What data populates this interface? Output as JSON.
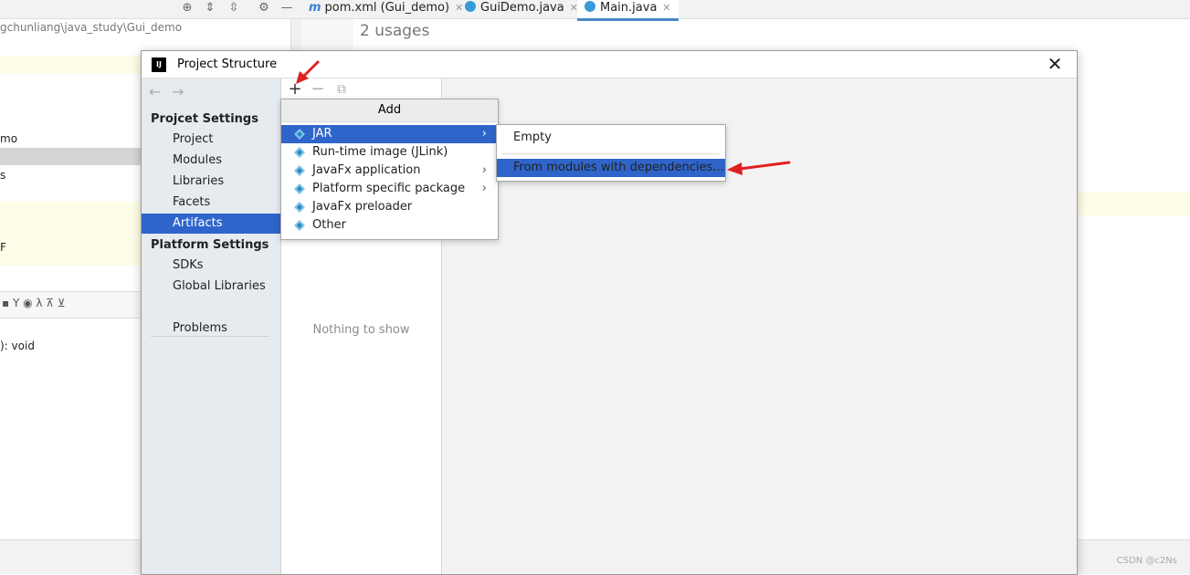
{
  "ide": {
    "breadcrumb_path": "gchunliang\\java_study\\Gui_demo",
    "tabs": [
      {
        "label": "pom.xml (Gui_demo)",
        "icon": "maven-icon",
        "active": false
      },
      {
        "label": "GuiDemo.java",
        "icon": "java-class-icon",
        "active": false
      },
      {
        "label": "Main.java",
        "icon": "java-class-icon",
        "active": true
      }
    ],
    "tab_close": "✕",
    "editor_hint": "2 usages",
    "tree_fragments": [
      "mo",
      "s",
      "F"
    ],
    "structure_line": "): void",
    "watermark": "CSDN @c2Ns"
  },
  "dialog": {
    "title": "Project Structure",
    "logo": "IJ",
    "close_icon": "✕",
    "nav_back": "←",
    "nav_forward": "→",
    "project_settings_header": "Projcet Settings",
    "project_settings_items": [
      "Project",
      "Modules",
      "Libraries",
      "Facets",
      "Artifacts"
    ],
    "selected_item": "Artifacts",
    "platform_settings_header": "Platform Settings",
    "platform_settings_items": [
      "SDKs",
      "Global Libraries"
    ],
    "problems": "Problems",
    "toolbar": {
      "add": "+",
      "remove": "−",
      "copy": "⧉"
    },
    "empty_text": "Nothing to show"
  },
  "add_popup": {
    "header": "Add",
    "items": [
      {
        "label": "JAR",
        "has_submenu": true,
        "selected": true
      },
      {
        "label": "Run-time image (JLink)",
        "has_submenu": false,
        "selected": false
      },
      {
        "label": "JavaFx application",
        "has_submenu": true,
        "selected": false
      },
      {
        "label": "Platform specific package",
        "has_submenu": true,
        "selected": false
      },
      {
        "label": "JavaFx preloader",
        "has_submenu": false,
        "selected": false
      },
      {
        "label": "Other",
        "has_submenu": false,
        "selected": false
      }
    ],
    "chevron": "›"
  },
  "jar_submenu": {
    "items": [
      {
        "label": "Empty",
        "selected": false
      },
      {
        "label": "From modules with dependencies...",
        "selected": true
      }
    ]
  },
  "colors": {
    "selection": "#2f65ca",
    "annotation_arrow": "#e02020",
    "artifact_icon": "#4fa8d8"
  }
}
